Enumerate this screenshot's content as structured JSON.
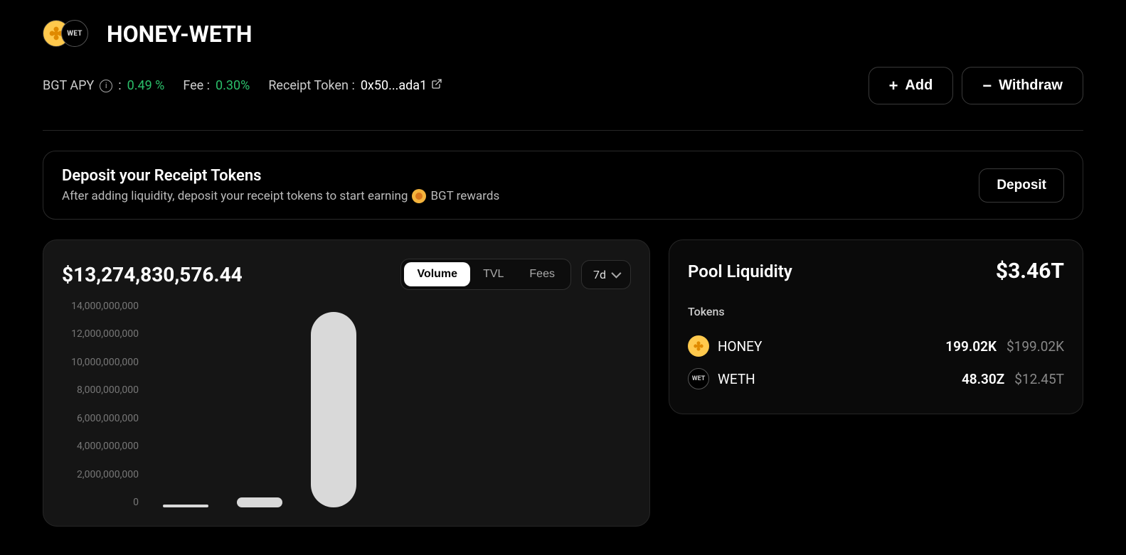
{
  "header": {
    "pool_name": "HONEY-WETH",
    "token_a_name": "HONEY",
    "token_b_label": "WET",
    "bgt_apy_label": "BGT APY",
    "bgt_apy_value": "0.49 %",
    "fee_label": "Fee :",
    "fee_value": "0.30%",
    "receipt_label": "Receipt Token :",
    "receipt_hash": "0x50...ada1",
    "add_label": "Add",
    "withdraw_label": "Withdraw"
  },
  "banner": {
    "title": "Deposit your Receipt Tokens",
    "subtitle_a": "After adding liquidity, deposit your receipt tokens to start earning",
    "subtitle_b": "BGT rewards",
    "button": "Deposit"
  },
  "chart": {
    "value": "$13,274,830,576.44",
    "tabs": {
      "volume": "Volume",
      "tvl": "TVL",
      "fees": "Fees",
      "active": "volume"
    },
    "range": "7d"
  },
  "chart_data": {
    "type": "bar",
    "categories": [
      "",
      "",
      ""
    ],
    "values": [
      50000000,
      700000000,
      13274830576.44
    ],
    "title": "",
    "xlabel": "",
    "ylabel": "",
    "ylim": [
      0,
      14000000000
    ],
    "y_ticks": [
      "14,000,000,000",
      "12,000,000,000",
      "10,000,000,000",
      "8,000,000,000",
      "6,000,000,000",
      "4,000,000,000",
      "2,000,000,000",
      "0"
    ]
  },
  "liquidity": {
    "title": "Pool Liquidity",
    "total": "$3.46T",
    "tokens_label": "Tokens",
    "rows": [
      {
        "symbol": "HONEY",
        "amount": "199.02K",
        "usd": "$199.02K",
        "icon": "honey"
      },
      {
        "symbol": "WETH",
        "amount": "48.30Z",
        "usd": "$12.45T",
        "icon": "weth"
      }
    ]
  }
}
